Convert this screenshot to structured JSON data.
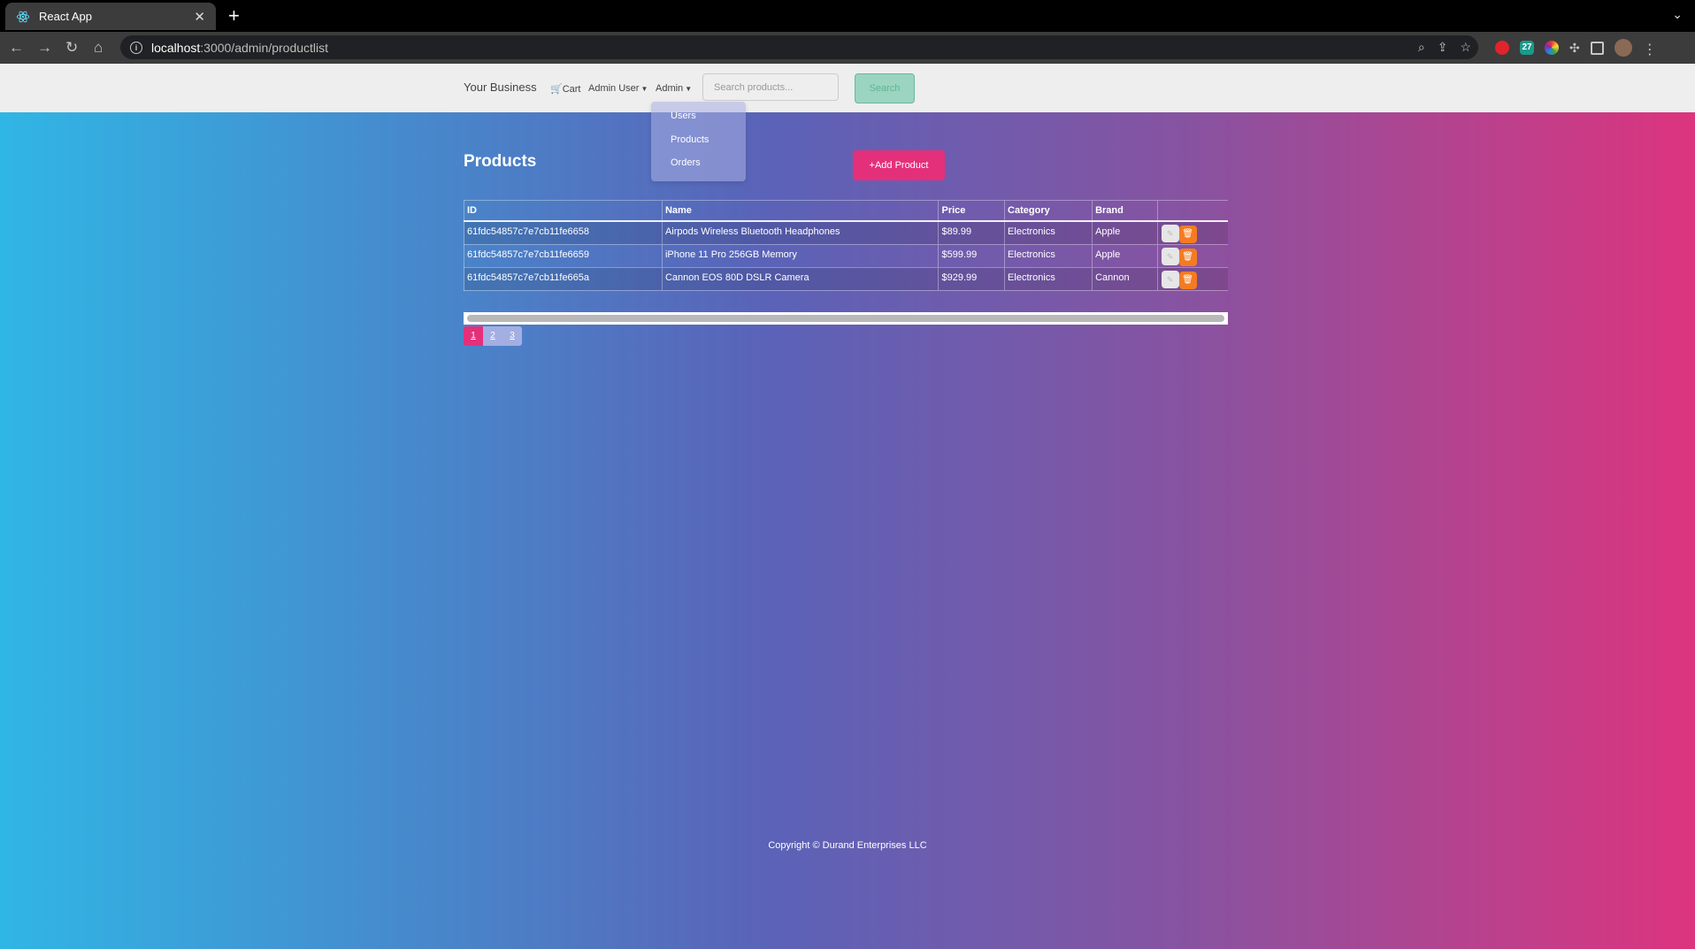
{
  "browser": {
    "tab_title": "React App",
    "url_host": "localhost",
    "url_path": ":3000/admin/productlist",
    "extension_badge": "27"
  },
  "navbar": {
    "brand": "Your Business",
    "cart": "Cart",
    "user_menu": "Admin User",
    "admin_menu": "Admin",
    "search_placeholder": "Search products...",
    "search_button": "Search"
  },
  "admin_dropdown": {
    "items": [
      {
        "label": "Users"
      },
      {
        "label": "Products"
      },
      {
        "label": "Orders"
      }
    ]
  },
  "main": {
    "title": "Products",
    "add_button": "+Add Product"
  },
  "table": {
    "headers": [
      "ID",
      "Name",
      "Price",
      "Category",
      "Brand",
      ""
    ],
    "rows": [
      {
        "id": "61fdc54857c7e7cb11fe6658",
        "name": "Airpods Wireless Bluetooth Headphones",
        "price": "$89.99",
        "category": "Electronics",
        "brand": "Apple"
      },
      {
        "id": "61fdc54857c7e7cb11fe6659",
        "name": "iPhone 11 Pro 256GB Memory",
        "price": "$599.99",
        "category": "Electronics",
        "brand": "Apple"
      },
      {
        "id": "61fdc54857c7e7cb11fe665a",
        "name": "Cannon EOS 80D DSLR Camera",
        "price": "$929.99",
        "category": "Electronics",
        "brand": "Cannon"
      }
    ]
  },
  "pagination": {
    "pages": [
      "1",
      "2",
      "3"
    ],
    "active": "1"
  },
  "footer": {
    "text": "Copyright © Durand Enterprises LLC"
  },
  "colors": {
    "accent_pink": "#e4307a",
    "delete_orange": "#f57b22",
    "search_green": "#9bd4c0",
    "gradient_start": "#30b6e4",
    "gradient_end": "#dd347e"
  }
}
